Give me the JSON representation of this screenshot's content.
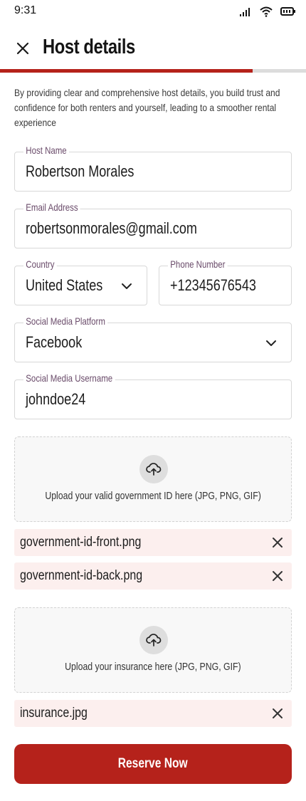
{
  "status_bar": {
    "time": "9:31"
  },
  "header": {
    "title": "Host details"
  },
  "progress": {
    "fraction": 0.825
  },
  "intro": "By providing clear and comprehensive host details, you build trust and confidence for both renters and yourself, leading to a smoother rental experience",
  "form": {
    "host_name": {
      "label": "Host Name",
      "value": "Robertson Morales"
    },
    "email": {
      "label": "Email Address",
      "value": "robertsonmorales@gmail.com"
    },
    "country": {
      "label": "Country",
      "value": "United States"
    },
    "phone": {
      "label": "Phone Number",
      "value": "+12345676543"
    },
    "social_platform": {
      "label": "Social Media Platform",
      "value": "Facebook"
    },
    "social_username": {
      "label": "Social Media Username",
      "value": "johndoe24"
    }
  },
  "government_id_upload": {
    "text": "Upload your valid government ID here (JPG, PNG, GIF)",
    "files": [
      "government-id-front.png",
      "government-id-back.png"
    ]
  },
  "insurance_upload": {
    "text": "Upload your insurance here (JPG, PNG, GIF)",
    "files": [
      "insurance.jpg"
    ]
  },
  "cta": {
    "label": "Reserve Now"
  },
  "colors": {
    "accent": "#b5221b",
    "chip_bg": "#fcefee",
    "label": "#6a4b6a"
  },
  "icons": [
    "signal-icon",
    "wifi-icon",
    "battery-icon",
    "close-icon",
    "chevron-down-icon",
    "upload-cloud-icon",
    "remove-file-icon"
  ]
}
